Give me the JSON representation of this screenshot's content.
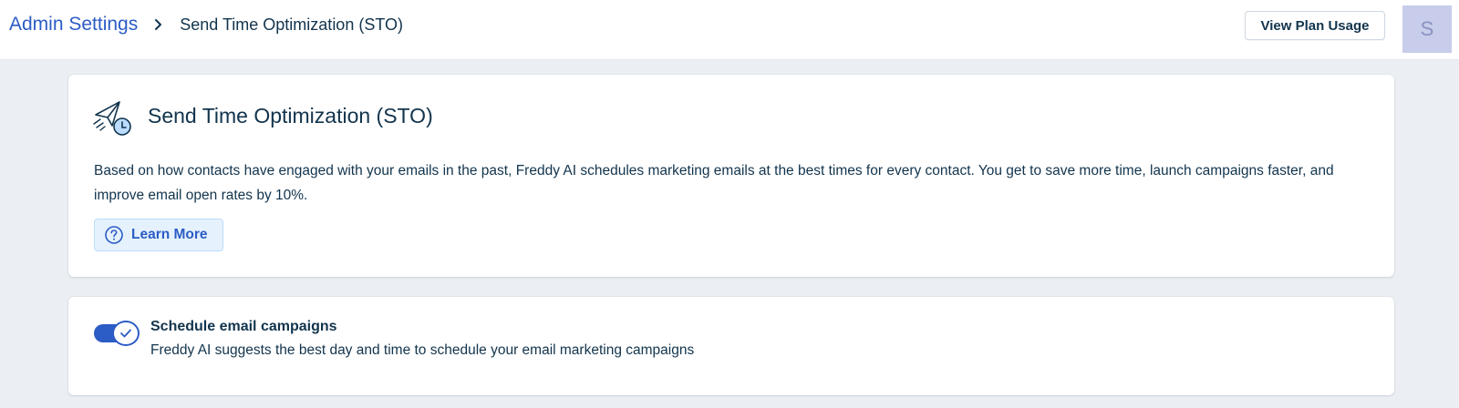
{
  "header": {
    "breadcrumb_root": "Admin Settings",
    "breadcrumb_current": "Send Time Optimization (STO)",
    "plan_button": "View Plan Usage",
    "avatar_initial": "S"
  },
  "sto_card": {
    "icon": "paper-plane-clock-icon",
    "title": "Send Time Optimization (STO)",
    "description": "Based on how contacts have engaged with your emails in the past, Freddy AI schedules marketing emails at the best times for every contact. You get to save more time, launch campaigns faster, and improve email open rates by 10%.",
    "learn_more_icon": "question-circle-icon",
    "learn_more_label": "Learn More"
  },
  "schedule_setting": {
    "enabled": true,
    "title": "Schedule email campaigns",
    "description": "Freddy AI suggests the best day and time to schedule your email marketing campaigns"
  },
  "colors": {
    "link_blue": "#2c5cc5",
    "text_dark": "#12344d",
    "page_bg": "#ebeff3",
    "learn_bg": "#e5f2fd",
    "avatar_bg": "#c7cdea"
  }
}
